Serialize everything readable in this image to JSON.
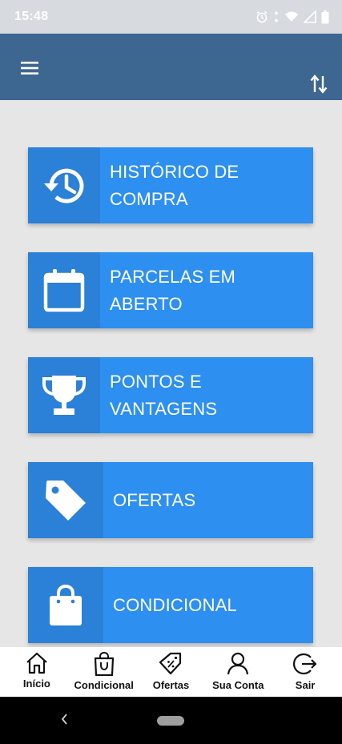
{
  "status_bar": {
    "time": "15:48",
    "icons": [
      "alarm-icon",
      "wifi-icon",
      "signal-icon",
      "battery-icon"
    ]
  },
  "app_bar": {
    "menu_icon": "hamburger-menu-icon",
    "action_icon": "sort-arrows-icon",
    "background": "#3d6690"
  },
  "tiles": [
    {
      "label": "HISTÓRICO DE COMPRA",
      "icon": "history-icon"
    },
    {
      "label": "PARCELAS EM ABERTO",
      "icon": "calendar-icon"
    },
    {
      "label": "PONTOS E VANTAGENS",
      "icon": "trophy-icon"
    },
    {
      "label": "OFERTAS",
      "icon": "tag-icon"
    },
    {
      "label": "CONDICIONAL",
      "icon": "shopping-bag-icon"
    }
  ],
  "bottom_nav": [
    {
      "label": "Início",
      "icon": "home-icon"
    },
    {
      "label": "Condicional",
      "icon": "bag-icon"
    },
    {
      "label": "Ofertas",
      "icon": "discount-tag-icon"
    },
    {
      "label": "Sua Conta",
      "icon": "user-icon"
    },
    {
      "label": "Sair",
      "icon": "logout-icon"
    }
  ],
  "colors": {
    "tile": "#2d8fef",
    "tile_icon_bg": "#2b80d7",
    "page_bg": "#e6e6e6"
  }
}
